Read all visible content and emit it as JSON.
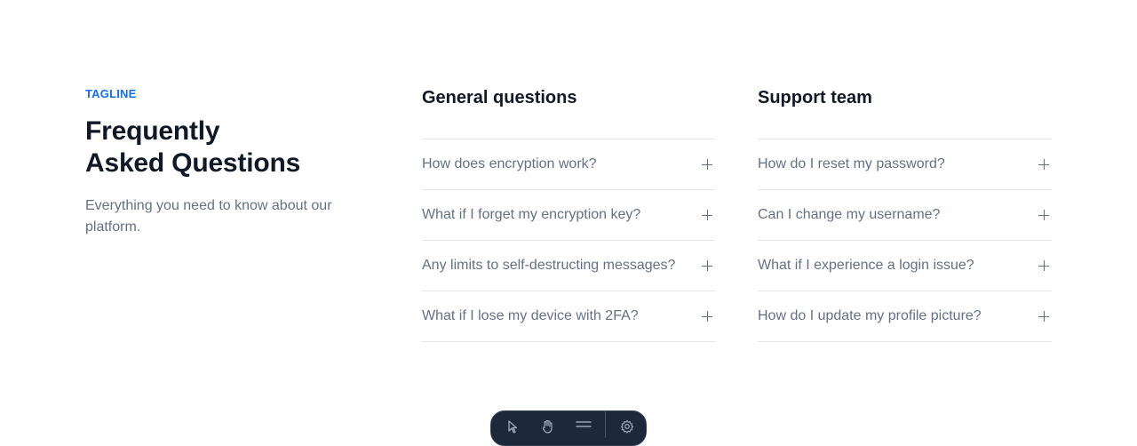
{
  "intro": {
    "tagline": "TAGLINE",
    "heading_line1": "Frequently",
    "heading_line2": "Asked Questions",
    "subtext": "Everything you need to know about our platform."
  },
  "general": {
    "title": "General questions",
    "items": [
      {
        "question": "How does encryption work?"
      },
      {
        "question": "What if I forget my encryption key?"
      },
      {
        "question": "Any limits to self-destructing messages?"
      },
      {
        "question": "What if I lose my device with 2FA?"
      }
    ]
  },
  "support": {
    "title": "Support team",
    "items": [
      {
        "question": "How do I reset my password?"
      },
      {
        "question": "Can I change my username?"
      },
      {
        "question": "What if I experience a login issue?"
      },
      {
        "question": "How do I update my profile picture?"
      }
    ]
  },
  "icons": {
    "expand": "plus-icon",
    "toolbar": [
      "pointer-icon",
      "hand-icon",
      "menu-icon",
      "gear-icon"
    ]
  },
  "colors": {
    "accent": "#1570ef",
    "heading": "#111827",
    "muted": "#667085",
    "divider": "#e4e7ec",
    "toolbar_bg": "#1d2939"
  }
}
